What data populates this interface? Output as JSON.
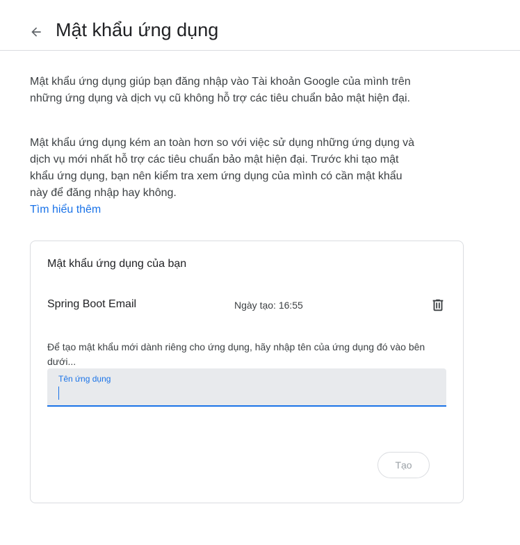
{
  "header": {
    "back_icon": "arrow-back-icon",
    "title": "Mật khẩu ứng dụng"
  },
  "description": {
    "paragraph1": "Mật khẩu ứng dụng giúp bạn đăng nhập vào Tài khoản Google của mình trên những ứng dụng và dịch vụ cũ không hỗ trợ các tiêu chuẩn bảo mật hiện đại.",
    "paragraph2": "Mật khẩu ứng dụng kém an toàn hơn so với việc sử dụng những ứng dụng và dịch vụ mới nhất hỗ trợ các tiêu chuẩn bảo mật hiện đại. Trước khi tạo mật khẩu ứng dụng, bạn nên kiểm tra xem ứng dụng của mình có cần mật khẩu này để đăng nhập hay không.",
    "learn_more": "Tìm hiểu thêm"
  },
  "card": {
    "title": "Mật khẩu ứng dụng của bạn",
    "passwords": [
      {
        "name": "Spring Boot Email",
        "created": "Ngày tạo: 16:55",
        "delete_icon": "trash-icon"
      }
    ],
    "hint": "Để tạo mật khẩu mới dành riêng cho ứng dụng, hãy nhập tên của ứng dụng đó vào bên dưới...",
    "input": {
      "label": "Tên ứng dụng",
      "value": ""
    },
    "create_button": "Tạo"
  },
  "colors": {
    "accent": "#1a73e8",
    "border": "#dadce0",
    "field_bg": "#e8eaed"
  }
}
